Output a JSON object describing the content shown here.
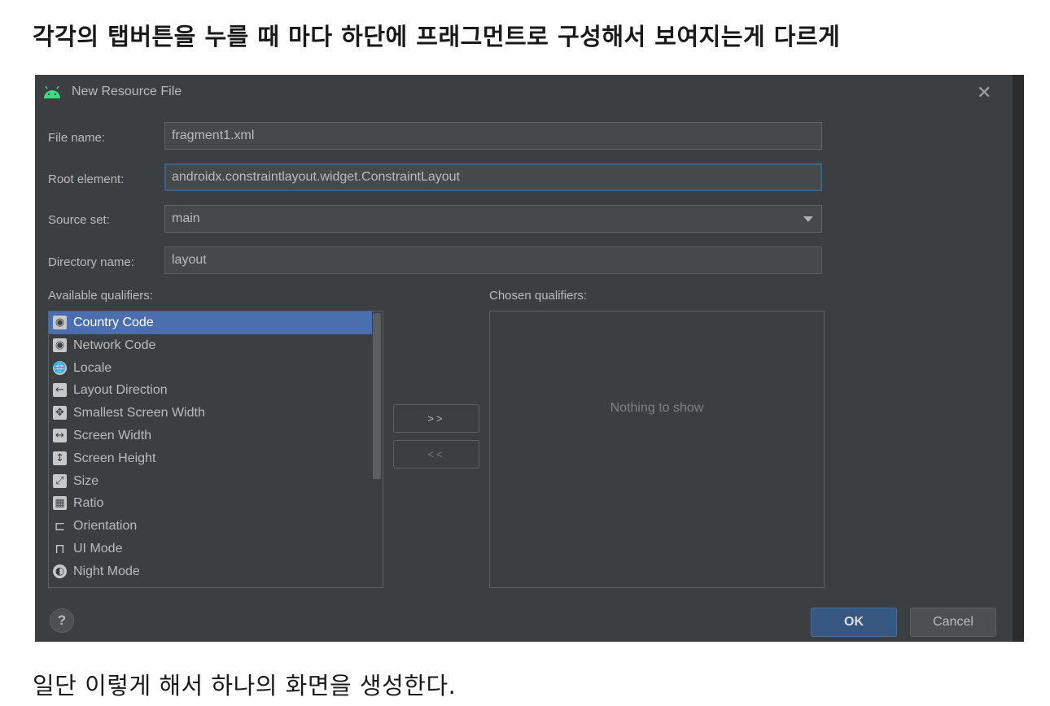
{
  "heading": "각각의 탭버튼을 누를 때 마다 하단에 프래그먼트로 구성해서 보여지는게 다르게",
  "caption": "일단 이렇게 해서 하나의 화면을 생성한다.",
  "dialog": {
    "title": "New Resource File",
    "close_glyph": "✕",
    "fields": {
      "file_name": {
        "label": "File name:",
        "value": "fragment1.xml"
      },
      "root_element": {
        "label": "Root element:",
        "value": "androidx.constraintlayout.widget.ConstraintLayout"
      },
      "source_set": {
        "label": "Source set:",
        "value": "main"
      },
      "directory_name": {
        "label": "Directory name:",
        "value": "layout"
      }
    },
    "available_label": "Available qualifiers:",
    "chosen_label": "Chosen qualifiers:",
    "qualifiers": [
      {
        "label": "Country Code",
        "icon": "country-code-icon",
        "glyph": "◉",
        "selected": true
      },
      {
        "label": "Network Code",
        "icon": "network-code-icon",
        "glyph": "◉",
        "selected": false
      },
      {
        "label": "Locale",
        "icon": "globe-icon",
        "glyph": "🌐",
        "selected": false
      },
      {
        "label": "Layout Direction",
        "icon": "arrow-left-icon",
        "glyph": "←",
        "selected": false
      },
      {
        "label": "Smallest Screen Width",
        "icon": "move-arrows-icon",
        "glyph": "✥",
        "selected": false
      },
      {
        "label": "Screen Width",
        "icon": "horizontal-arrows-icon",
        "glyph": "↔",
        "selected": false
      },
      {
        "label": "Screen Height",
        "icon": "vertical-arrows-icon",
        "glyph": "↕",
        "selected": false
      },
      {
        "label": "Size",
        "icon": "diagonal-resize-icon",
        "glyph": "⤢",
        "selected": false
      },
      {
        "label": "Ratio",
        "icon": "ratio-icon",
        "glyph": "▦",
        "selected": false
      },
      {
        "label": "Orientation",
        "icon": "orientation-icon",
        "glyph": "⊏",
        "selected": false
      },
      {
        "label": "UI Mode",
        "icon": "ui-mode-icon",
        "glyph": "⊓",
        "selected": false
      },
      {
        "label": "Night Mode",
        "icon": "night-mode-icon",
        "glyph": "◐",
        "selected": false
      }
    ],
    "add_button": ">>",
    "remove_button": "<<",
    "empty_chosen": "Nothing to show",
    "help_glyph": "?",
    "ok_label": "OK",
    "cancel_label": "Cancel"
  },
  "colors": {
    "dialog_bg": "#3c3f41",
    "selected_row": "#4b6eaf",
    "ok_button": "#365880",
    "android_green": "#3ddc84"
  }
}
